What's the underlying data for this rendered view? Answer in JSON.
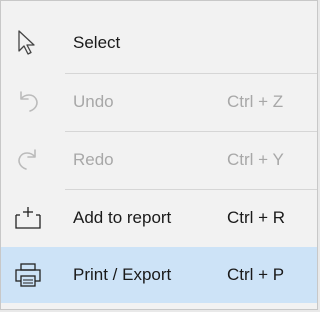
{
  "menu": {
    "items": [
      {
        "label": "Select",
        "shortcut": "",
        "icon": "cursor-arrow-icon",
        "enabled": true
      },
      {
        "label": "Undo",
        "shortcut": "Ctrl + Z",
        "icon": "undo-arrow-icon",
        "enabled": false
      },
      {
        "label": "Redo",
        "shortcut": "Ctrl + Y",
        "icon": "redo-arrow-icon",
        "enabled": false
      },
      {
        "label": "Add to report",
        "shortcut": "Ctrl + R",
        "icon": "add-to-report-icon",
        "enabled": true
      },
      {
        "label": "Print / Export",
        "shortcut": "Ctrl + P",
        "icon": "printer-icon",
        "enabled": true,
        "highlighted": true
      }
    ]
  },
  "colors": {
    "highlight": "#cde3f7",
    "text": "#1a1a1a",
    "disabled_text": "#a8a8a8",
    "menu_background": "#f2f2f2"
  }
}
